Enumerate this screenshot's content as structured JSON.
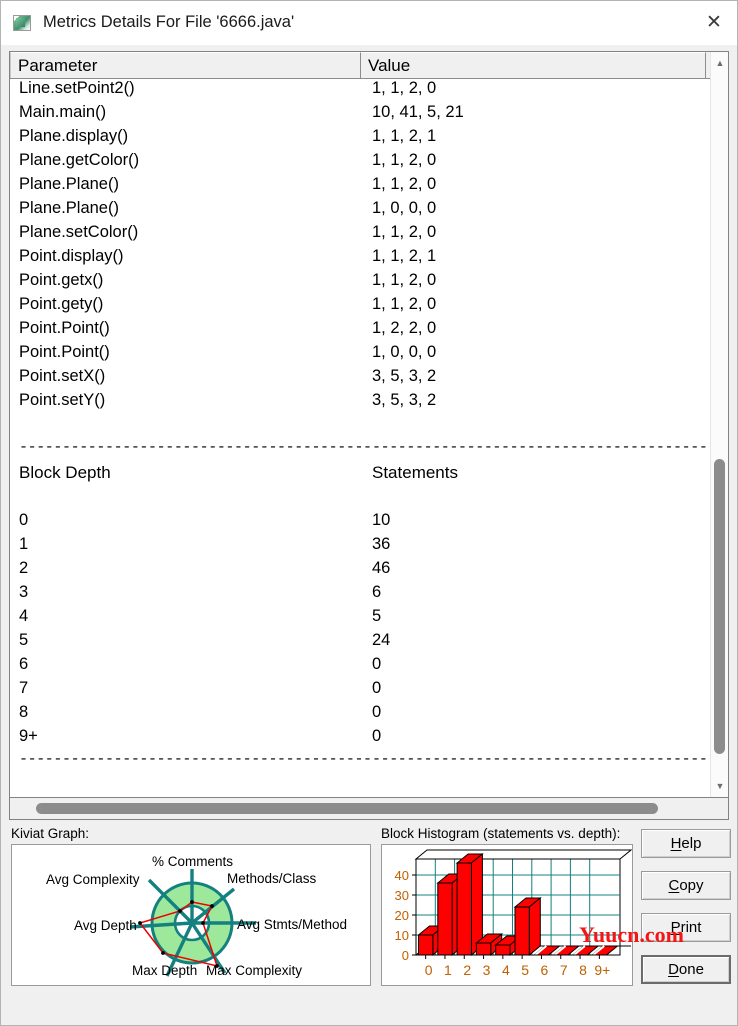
{
  "window": {
    "title": "Metrics Details For File '6666.java'",
    "icon": "metrics-app-icon",
    "close_label": "✕"
  },
  "table": {
    "columns": [
      "Parameter",
      "Value"
    ],
    "rows": [
      {
        "parameter": "Line.setPoint2()",
        "value": "1, 1, 2, 0"
      },
      {
        "parameter": "Main.main()",
        "value": "10, 41, 5, 21"
      },
      {
        "parameter": "Plane.display()",
        "value": "1, 1, 2, 1"
      },
      {
        "parameter": "Plane.getColor()",
        "value": "1, 1, 2, 0"
      },
      {
        "parameter": "Plane.Plane()",
        "value": "1, 1, 2, 0"
      },
      {
        "parameter": "Plane.Plane()",
        "value": "1, 0, 0, 0"
      },
      {
        "parameter": "Plane.setColor()",
        "value": "1, 1, 2, 0"
      },
      {
        "parameter": "Point.display()",
        "value": "1, 1, 2, 1"
      },
      {
        "parameter": "Point.getx()",
        "value": "1, 1, 2, 0"
      },
      {
        "parameter": "Point.gety()",
        "value": "1, 1, 2, 0"
      },
      {
        "parameter": "Point.Point()",
        "value": "1, 2, 2, 0"
      },
      {
        "parameter": "Point.Point()",
        "value": "1, 0, 0, 0"
      },
      {
        "parameter": "Point.setX()",
        "value": "3, 5, 3, 2"
      },
      {
        "parameter": "Point.setY()",
        "value": "3, 5, 3, 2"
      }
    ],
    "separator_a": "-----------------------------------------",
    "separator_b": "-----------------------------------------------",
    "section": {
      "header_a": "Block Depth",
      "header_b": "Statements",
      "rows": [
        {
          "depth": "0",
          "statements": "10"
        },
        {
          "depth": "1",
          "statements": "36"
        },
        {
          "depth": "2",
          "statements": "46"
        },
        {
          "depth": "3",
          "statements": "6"
        },
        {
          "depth": "4",
          "statements": "5"
        },
        {
          "depth": "5",
          "statements": "24"
        },
        {
          "depth": "6",
          "statements": "0"
        },
        {
          "depth": "7",
          "statements": "0"
        },
        {
          "depth": "8",
          "statements": "0"
        },
        {
          "depth": "9+",
          "statements": "0"
        }
      ]
    }
  },
  "kiviat": {
    "label": "Kiviat Graph:",
    "axes": [
      "% Comments",
      "Methods/Class",
      "Avg Stmts/Method",
      "Max Complexity",
      "Max Depth",
      "Avg Depth",
      "Avg Complexity"
    ],
    "band_color": "#9ee89b",
    "spoke_color": "#14807f",
    "plot_color": "#ee0000"
  },
  "histogram": {
    "label": "Block Histogram (statements vs. depth):",
    "bar_color": "#ff0000",
    "grid_color": "#14807f",
    "tick_color": "#c06000"
  },
  "chart_data": {
    "type": "bar",
    "title": "Block Histogram (statements vs. depth)",
    "xlabel": "depth",
    "ylabel": "statements",
    "categories": [
      "0",
      "1",
      "2",
      "3",
      "4",
      "5",
      "6",
      "7",
      "8",
      "9+"
    ],
    "values": [
      10,
      36,
      46,
      6,
      5,
      24,
      0,
      0,
      0,
      0
    ],
    "yticks": [
      0,
      10,
      20,
      30,
      40
    ],
    "ylim": [
      0,
      48
    ],
    "grid": true,
    "legend": "none"
  },
  "buttons": [
    {
      "name": "help",
      "label": "Help",
      "mnemonic": "H",
      "rest": "elp",
      "focused": false
    },
    {
      "name": "copy",
      "label": "Copy",
      "mnemonic": "C",
      "rest": "opy",
      "focused": false
    },
    {
      "name": "print",
      "label": "Print",
      "mnemonic": "P",
      "rest": "rint",
      "focused": false
    },
    {
      "name": "done",
      "label": "Done",
      "mnemonic": "D",
      "rest": "one",
      "focused": true
    }
  ],
  "watermark": "Yuucn.com"
}
